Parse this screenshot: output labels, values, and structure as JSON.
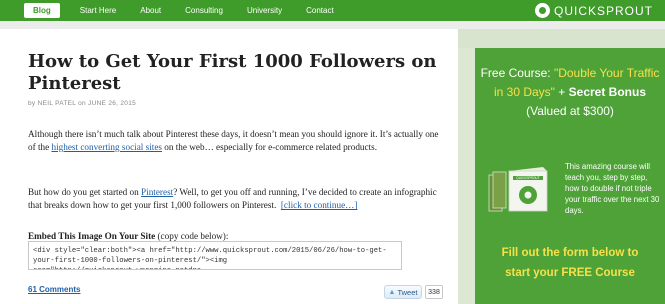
{
  "nav": {
    "items": [
      "Blog",
      "Start Here",
      "About",
      "Consulting",
      "University",
      "Contact"
    ],
    "logo_text": "QUICKSPROUT"
  },
  "article": {
    "title": "How to Get Your First 1000 Followers on Pinterest",
    "byline_by": "by",
    "author": "NEIL PATEL",
    "byline_on": "on",
    "date": "JUNE 26, 2015",
    "p1_a": "Although there isn’t much talk about Pinterest these days, it doesn’t mean you should ignore it. It’s actually one of the ",
    "p1_link": "highest converting social sites",
    "p1_b": " on the web… especially for e-commerce related products.",
    "p2_a": "But how do you get started on ",
    "p2_link": "Pinterest",
    "p2_b": "? Well, to get you off and running, I’ve decided to create an infographic that breaks down how to get your first 1,000 followers on Pinterest.",
    "continue_link": "[click to continue…]",
    "embed_label_bold": "Embed This Image On Your Site",
    "embed_label_rest": " (copy code below):",
    "embed_code": "<div style=\"clear:both\"><a href=\"http://www.quicksprout.com/2015/06/26/how-to-get-your-first-1000-followers-on-pinterest/\"><img src=\"http://quicksprout.wpengine.netdna-",
    "comments": "61 Comments",
    "tweet_label": "Tweet",
    "tweet_count": "338"
  },
  "sidebar": {
    "head_line1_a": "Free Course: ",
    "head_line1_b": "\"Double Your Traffic",
    "head_line2_a": "in 30 Days\"",
    "head_line2_b": " + ",
    "head_line2_c": "Secret Bonus",
    "head_line3": "(Valued at $300)",
    "box_label": "QUICKSPROUT",
    "body": "This amazing course will teach you, step by step, how to double if not triple your traffic over the next 30 days.",
    "cta_line1": "Fill out the form below to",
    "cta_line2": "start your FREE Course"
  },
  "colors": {
    "brand_green": "#3f9b2a",
    "promo_green": "#4ea237",
    "accent_yellow": "#f7e14a",
    "link_blue": "#1f5fa8"
  }
}
